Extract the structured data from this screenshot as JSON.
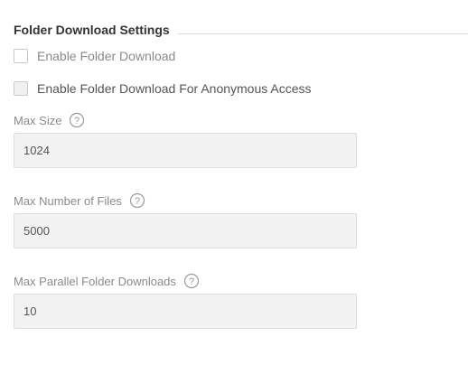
{
  "section": {
    "title": "Folder Download Settings"
  },
  "options": {
    "enable_folder_download": {
      "label": "Enable Folder Download",
      "checked": false,
      "disabled": false
    },
    "enable_anonymous": {
      "label": "Enable Folder Download For Anonymous Access",
      "checked": false,
      "disabled": true
    }
  },
  "fields": {
    "max_size": {
      "label": "Max Size",
      "value": "1024"
    },
    "max_files": {
      "label": "Max Number of Files",
      "value": "5000"
    },
    "max_parallel": {
      "label": "Max Parallel Folder Downloads",
      "value": "10"
    }
  },
  "icons": {
    "help": "help-circle-icon"
  },
  "colors": {
    "title": "#333333",
    "label": "#8a8a8a",
    "input_bg": "#f2f2f2",
    "border": "#dedede"
  }
}
